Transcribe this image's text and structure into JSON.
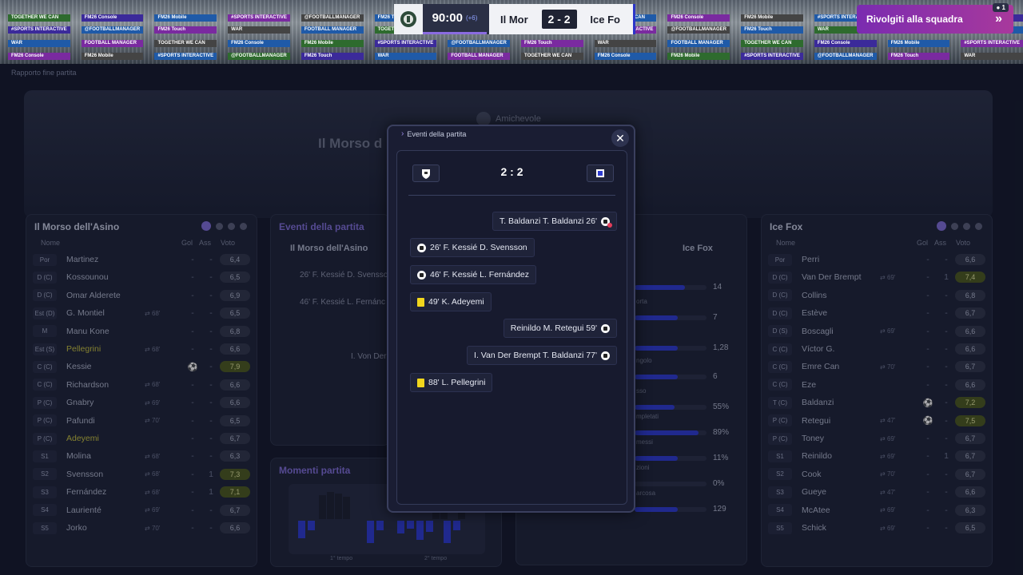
{
  "breadcrumb": "Rapporto fine partita",
  "scoreboard": {
    "time": "90:00",
    "added": "(+6)",
    "home": "Il Mor",
    "score": "2 - 2",
    "away": "Ice Fo"
  },
  "cta": {
    "label": "Rivolgiti alla squadra",
    "badge": "1"
  },
  "competition": "Amichevole",
  "hero_title": "Il Morso d",
  "stadium_boards": [
    "TOGETHER WE CAN",
    "FM26 Console",
    "FM26 Mobile",
    "#SPORTS INTERACTIVE",
    "@FOOTBALLMANAGER",
    "FM26 Touch",
    "WAR",
    "FOOTBALL MANAGER"
  ],
  "home_panel": {
    "title": "Il Morso dell'Asino",
    "cols": {
      "name": "Nome",
      "gol": "Gol",
      "ass": "Ass",
      "voto": "Voto"
    },
    "players": [
      {
        "pos": "Por",
        "name": "Martinez",
        "sub": "",
        "gol": "-",
        "ass": "-",
        "voto": "6,4",
        "hl": false,
        "yl": false
      },
      {
        "pos": "D (C)",
        "name": "Kossounou",
        "sub": "",
        "gol": "-",
        "ass": "-",
        "voto": "6,5",
        "hl": false,
        "yl": false
      },
      {
        "pos": "D (C)",
        "name": "Omar Alderete",
        "sub": "",
        "gol": "-",
        "ass": "-",
        "voto": "6,9",
        "hl": false,
        "yl": false
      },
      {
        "pos": "Est (D)",
        "name": "G. Montiel",
        "sub": "68'",
        "gol": "-",
        "ass": "-",
        "voto": "6,5",
        "hl": false,
        "yl": false
      },
      {
        "pos": "M",
        "name": "Manu Kone",
        "sub": "",
        "gol": "-",
        "ass": "-",
        "voto": "6,8",
        "hl": false,
        "yl": false
      },
      {
        "pos": "Est (S)",
        "name": "Pellegrini",
        "sub": "68'",
        "gol": "-",
        "ass": "-",
        "voto": "6,6",
        "hl": false,
        "yl": true
      },
      {
        "pos": "C (C)",
        "name": "Kessie",
        "sub": "",
        "gol": "",
        "ass": "-",
        "voto": "7,9",
        "hl": true,
        "yl": false
      },
      {
        "pos": "C (C)",
        "name": "Richardson",
        "sub": "68'",
        "gol": "-",
        "ass": "-",
        "voto": "6,6",
        "hl": false,
        "yl": false
      },
      {
        "pos": "P (C)",
        "name": "Gnabry",
        "sub": "69'",
        "gol": "-",
        "ass": "-",
        "voto": "6,6",
        "hl": false,
        "yl": false
      },
      {
        "pos": "P (C)",
        "name": "Pafundi",
        "sub": "70'",
        "gol": "-",
        "ass": "-",
        "voto": "6,5",
        "hl": false,
        "yl": false
      },
      {
        "pos": "P (C)",
        "name": "Adeyemi",
        "sub": "",
        "gol": "-",
        "ass": "-",
        "voto": "6,7",
        "hl": false,
        "yl": true
      },
      {
        "pos": "S1",
        "name": "Molina",
        "sub": "68'",
        "gol": "-",
        "ass": "-",
        "voto": "6,3",
        "hl": false,
        "yl": false
      },
      {
        "pos": "S2",
        "name": "Svensson",
        "sub": "68'",
        "gol": "-",
        "ass": "1",
        "voto": "7,3",
        "hl": true,
        "yl": false
      },
      {
        "pos": "S3",
        "name": "Fernández",
        "sub": "68'",
        "gol": "-",
        "ass": "1",
        "voto": "7,1",
        "hl": true,
        "yl": false
      },
      {
        "pos": "S4",
        "name": "Laurienté",
        "sub": "69'",
        "gol": "-",
        "ass": "-",
        "voto": "6,7",
        "hl": false,
        "yl": false
      },
      {
        "pos": "S5",
        "name": "Jorko",
        "sub": "70'",
        "gol": "-",
        "ass": "-",
        "voto": "6,6",
        "hl": false,
        "yl": false
      }
    ]
  },
  "away_panel": {
    "title": "Ice Fox",
    "cols": {
      "name": "Nome",
      "gol": "Gol",
      "ass": "Ass",
      "voto": "Voto"
    },
    "players": [
      {
        "pos": "Por",
        "name": "Perri",
        "sub": "",
        "gol": "-",
        "ass": "-",
        "voto": "6,6",
        "hl": false,
        "yl": false
      },
      {
        "pos": "D (C)",
        "name": "Van Der Brempt",
        "sub": "69'",
        "gol": "-",
        "ass": "1",
        "voto": "7,4",
        "hl": true,
        "yl": false
      },
      {
        "pos": "D (C)",
        "name": "Collins",
        "sub": "",
        "gol": "-",
        "ass": "-",
        "voto": "6,8",
        "hl": false,
        "yl": false
      },
      {
        "pos": "D (C)",
        "name": "Estève",
        "sub": "",
        "gol": "-",
        "ass": "-",
        "voto": "6,7",
        "hl": false,
        "yl": false
      },
      {
        "pos": "D (S)",
        "name": "Boscagli",
        "sub": "69'",
        "gol": "-",
        "ass": "-",
        "voto": "6,6",
        "hl": false,
        "yl": false
      },
      {
        "pos": "C (C)",
        "name": "Víctor G.",
        "sub": "",
        "gol": "-",
        "ass": "-",
        "voto": "6,6",
        "hl": false,
        "yl": false
      },
      {
        "pos": "C (C)",
        "name": "Emre Can",
        "sub": "70'",
        "gol": "-",
        "ass": "-",
        "voto": "6,7",
        "hl": false,
        "yl": false
      },
      {
        "pos": "C (C)",
        "name": "Eze",
        "sub": "",
        "gol": "-",
        "ass": "-",
        "voto": "6,6",
        "hl": false,
        "yl": false
      },
      {
        "pos": "T (C)",
        "name": "Baldanzi",
        "sub": "",
        "gol": "",
        "ass": "-",
        "voto": "7,2",
        "hl": true,
        "yl": false
      },
      {
        "pos": "P (C)",
        "name": "Retegui",
        "sub": "47'",
        "gol": "",
        "ass": "-",
        "voto": "7,5",
        "hl": true,
        "yl": false
      },
      {
        "pos": "P (C)",
        "name": "Toney",
        "sub": "69'",
        "gol": "-",
        "ass": "-",
        "voto": "6,7",
        "hl": false,
        "yl": false
      },
      {
        "pos": "S1",
        "name": "Reinildo",
        "sub": "69'",
        "gol": "-",
        "ass": "1",
        "voto": "6,7",
        "hl": false,
        "yl": false
      },
      {
        "pos": "S2",
        "name": "Cook",
        "sub": "70'",
        "gol": "-",
        "ass": "-",
        "voto": "6,7",
        "hl": false,
        "yl": false
      },
      {
        "pos": "S3",
        "name": "Gueye",
        "sub": "47'",
        "gol": "-",
        "ass": "-",
        "voto": "6,6",
        "hl": false,
        "yl": false
      },
      {
        "pos": "S4",
        "name": "McAtee",
        "sub": "69'",
        "gol": "-",
        "ass": "-",
        "voto": "6,3",
        "hl": false,
        "yl": false
      },
      {
        "pos": "S5",
        "name": "Schick",
        "sub": "69'",
        "gol": "-",
        "ass": "-",
        "voto": "6,5",
        "hl": false,
        "yl": false
      }
    ]
  },
  "events_bg": {
    "title": "Eventi della partita",
    "home": "Il Morso dell'Asino",
    "away": "Ice Fox",
    "rows": [
      "26' F. Kessié D. Svensso",
      "46' F. Kessié L. Fernánc"
    ],
    "frag": "I. Von Der"
  },
  "stats_bg": {
    "values": [
      "14",
      "7",
      "1,28",
      "6",
      "55%",
      "89%",
      "11%",
      "0%",
      "129"
    ],
    "fills": [
      0.7,
      0.6,
      0.6,
      0.6,
      0.55,
      0.89,
      0.6,
      0.0,
      0.6
    ],
    "labels": [
      "orta",
      "ngolo",
      "sso",
      "mpletati",
      "messi",
      "zioni",
      "arcosa"
    ]
  },
  "momenti": {
    "title": "Momenti partita",
    "t1": "1° tempo",
    "t2": "2° tempo"
  },
  "modal": {
    "title": "Eventi della partita",
    "score": "2 : 2",
    "events": [
      {
        "side": "away",
        "text": "T. Baldanzi T. Baldanzi 26'",
        "icon": "own-goal"
      },
      {
        "side": "home",
        "text": "26' F. Kessié D. Svensson",
        "icon": "goal"
      },
      {
        "side": "home",
        "text": "46' F. Kessié L. Fernández",
        "icon": "goal"
      },
      {
        "side": "home",
        "text": "49' K. Adeyemi",
        "icon": "yellow-card"
      },
      {
        "side": "away",
        "text": "Reinildo M. Retegui 59'",
        "icon": "goal"
      },
      {
        "side": "away",
        "text": "I. Van Der Brempt T. Baldanzi 77'",
        "icon": "goal"
      },
      {
        "side": "home",
        "text": "88' L. Pellegrini",
        "icon": "yellow-card"
      }
    ]
  },
  "colors": {
    "accent": "#7f6ed6",
    "away_bar": "#2d3bd0",
    "rating_high": "#4c5a1f",
    "cta": "#a8399c"
  }
}
